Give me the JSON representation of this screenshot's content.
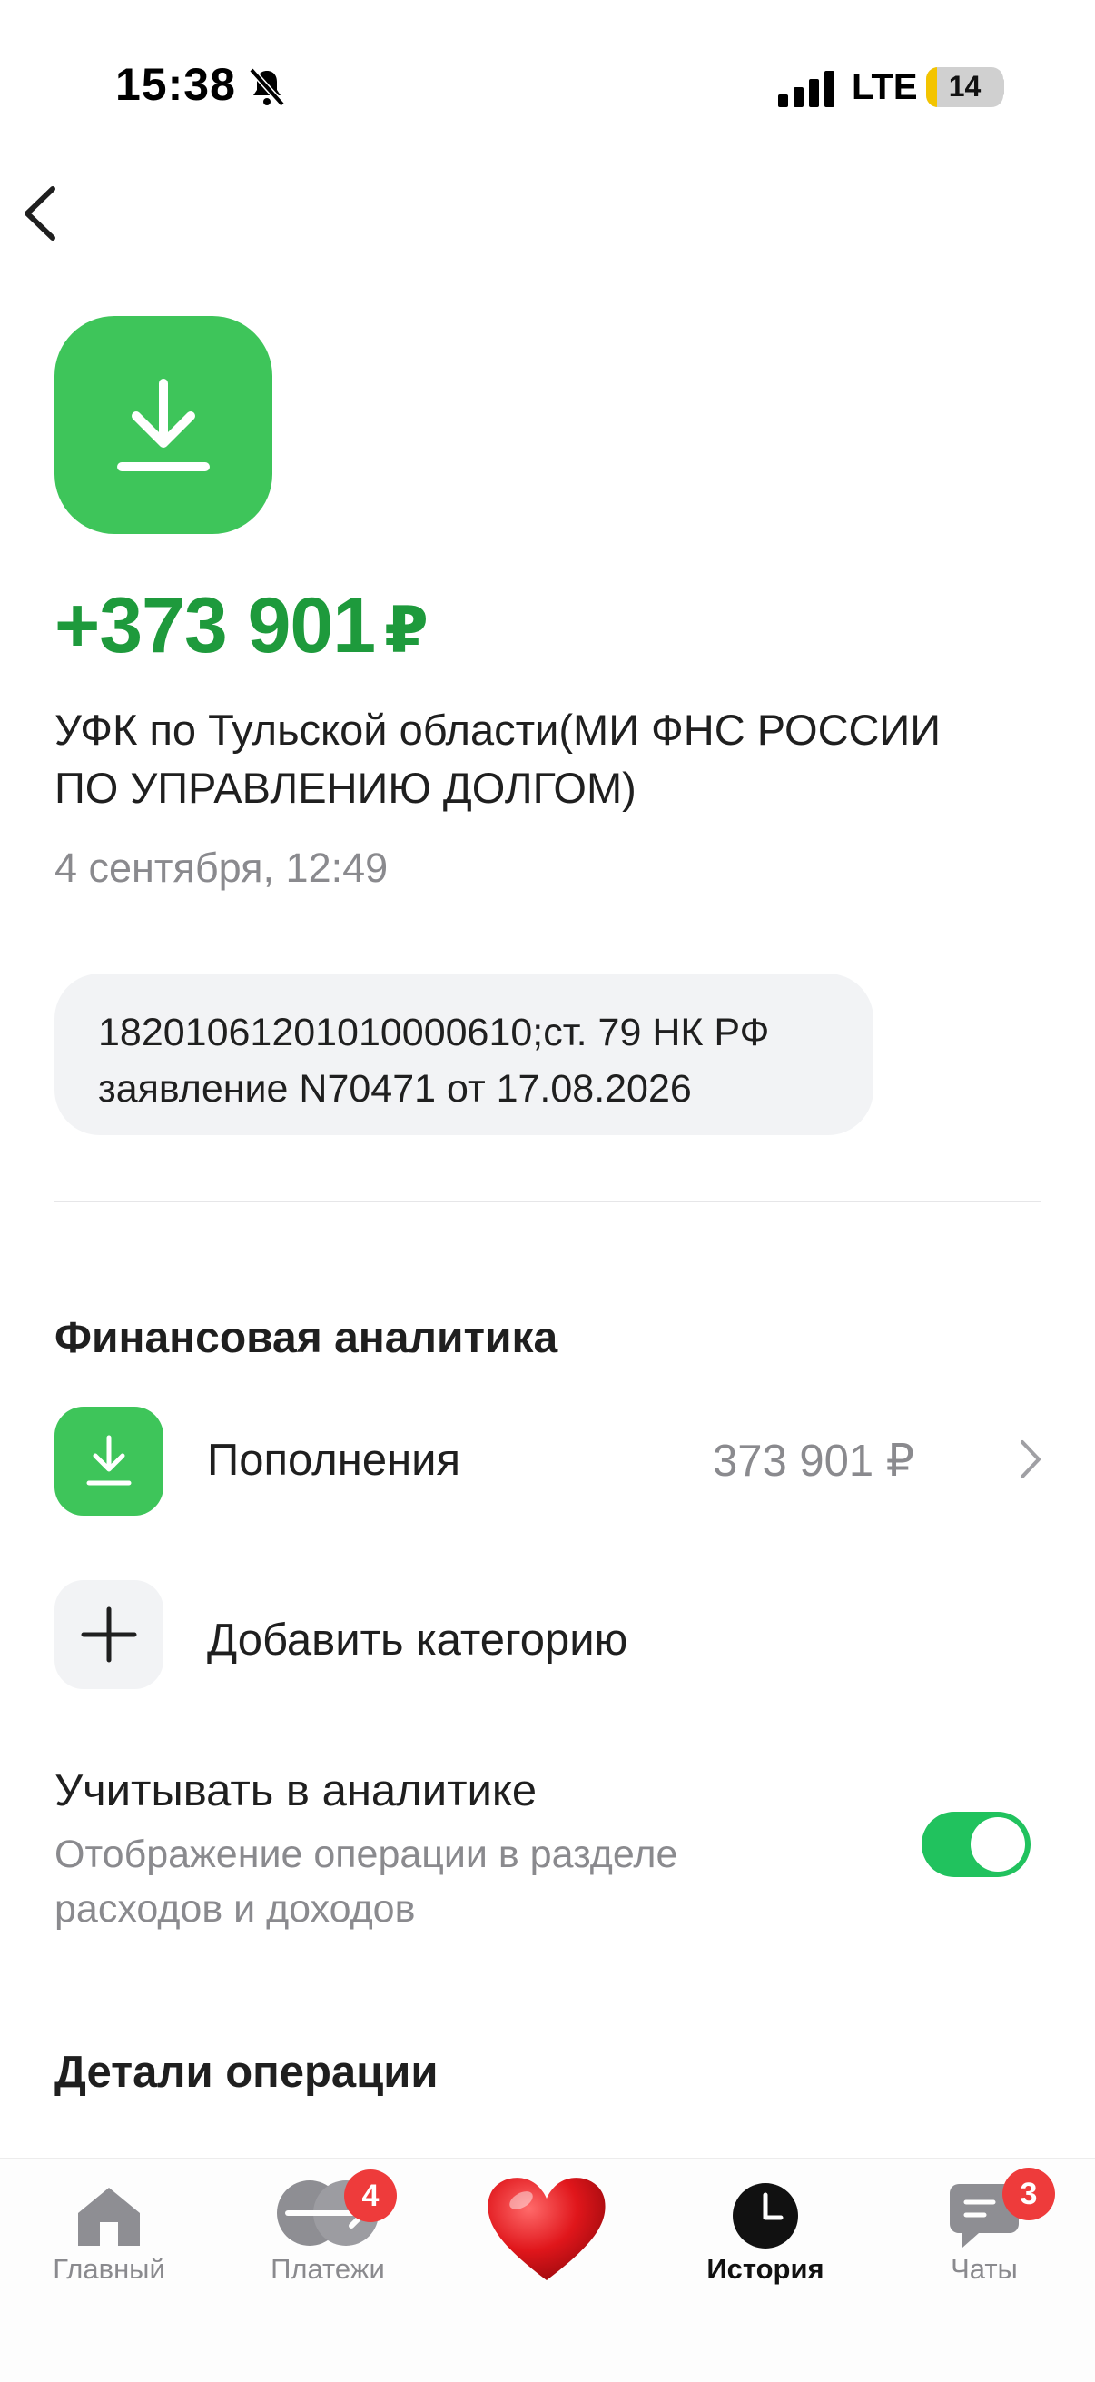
{
  "status_bar": {
    "time": "15:38",
    "network": "LTE",
    "battery": "14",
    "battery_fraction": 0.14
  },
  "transaction": {
    "amount": "+373 901",
    "currency": "₽",
    "payer_line1": "УФК по Тульской области(МИ ФНС РОССИИ",
    "payer_line2": "ПО УПРАВЛЕНИЮ ДОЛГОМ)",
    "date": "4 сентября, 12:49",
    "purpose_line1": "18201061201010000610;ст. 79 НК РФ",
    "purpose_line2": "заявление N70471 от 17.08.2026"
  },
  "analytics": {
    "title": "Финансовая аналитика",
    "category_label": "Пополнения",
    "category_amount": "373 901 ₽",
    "add_category_label": "Добавить категорию",
    "include_title": "Учитывать в аналитике",
    "include_desc_line1": "Отображение операции в разделе",
    "include_desc_line2": "расходов и доходов",
    "include_enabled": true
  },
  "details": {
    "title": "Детали операции"
  },
  "tabbar": {
    "tabs": [
      {
        "label": "Главный"
      },
      {
        "label": "Платежи",
        "badge": "4"
      },
      {
        "label": ""
      },
      {
        "label": "История"
      },
      {
        "label": "Чаты",
        "badge": "3"
      }
    ]
  },
  "colors": {
    "green": "#3ec55a",
    "amount_green": "#1e9a3c",
    "toggle_on": "#21c25e",
    "badge_red": "#ee3b3b"
  },
  "icons": [
    "bell-slash-icon",
    "signal-icon",
    "battery-icon",
    "back-arrow-icon",
    "download-icon",
    "chevron-right-icon",
    "plus-icon",
    "home-icon",
    "payments-icon",
    "heart-icon",
    "clock-icon",
    "chat-icon"
  ]
}
